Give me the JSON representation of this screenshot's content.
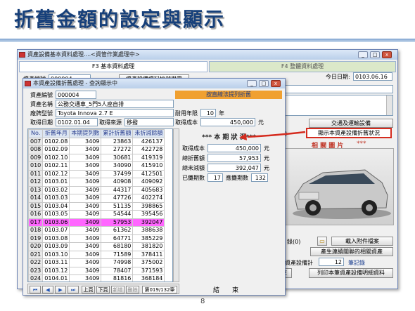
{
  "slide": {
    "title": "折舊金額的設定與顯示",
    "page_number": "8"
  },
  "back_window": {
    "title": "資產設備基本資料處理....<資管作業處理中>",
    "tab_f3": "F3 基本資料處理",
    "tab_f4": "F4 整體資料處理",
    "today_label": "今日日期:",
    "today_value": "0103.06.16",
    "asset_no_label": "資產編號",
    "asset_no_value": "000004",
    "history_button": "資產設備資料挫啟與露",
    "spec_value": "2.7 E",
    "transfer_button": "交通及運輸設備",
    "depr_status_button": "顯示本資產設備折舊狀況",
    "photo_label": "相 關 圖 片",
    "record_label": "錄(0)",
    "attachment_button": "載入附件檔案",
    "related_docs_button": "產生連續關聯的相關資產",
    "asset_count_label": "資產設備計",
    "asset_count_value": "12",
    "record_unit": "筆記錄",
    "end_button": "結束",
    "list_button": "列印本筆資產設備明細資料"
  },
  "front_window": {
    "title": "本資產設備折舊處理 - 查詢顯示中",
    "asset_no_label": "資產編號",
    "asset_no_value": "000004",
    "name_label": "資產名稱",
    "name_value": "公務交通車_5門5人座自排",
    "brand_label": "廠牌型號",
    "brand_value": "Toyota Innova 2.7 E",
    "life_label": "耐用年限",
    "life_value": "10",
    "life_unit": "年",
    "acq_date_label": "取得日期",
    "acq_date_value": "0102.01.04",
    "source_label": "取得來源",
    "source_value": "移撥",
    "cost_label": "取得成本",
    "cost_value": "450,000",
    "cost_unit": "元",
    "method_value": "按直線法提列折舊",
    "status_heading": "*** 本 期 狀 況***",
    "status_cost_label": "取得成本",
    "status_cost_value": "450,000",
    "total_depr_label": "總折舊額",
    "total_depr_value": "57,953",
    "remaining_label": "總未減額",
    "remaining_value": "392,047",
    "used_periods_label": "已攤期數",
    "used_periods_value": "17",
    "remaining_periods_label": "應攤期數",
    "remaining_periods_value": "132",
    "bottom_label": "結　　束",
    "table": {
      "headers": [
        "No.",
        "折舊年月",
        "本期提列數",
        "累計折舊額",
        "未折減餘額"
      ],
      "rows": [
        [
          "007",
          "0102.08",
          "3409",
          "23863",
          "426137"
        ],
        [
          "008",
          "0102.09",
          "3409",
          "27272",
          "422728"
        ],
        [
          "009",
          "0102.10",
          "3409",
          "30681",
          "419319"
        ],
        [
          "010",
          "0102.11",
          "3409",
          "34090",
          "415910"
        ],
        [
          "011",
          "0102.12",
          "3409",
          "37499",
          "412501"
        ],
        [
          "012",
          "0103.01",
          "3409",
          "40908",
          "409092"
        ],
        [
          "013",
          "0103.02",
          "3409",
          "44317",
          "405683"
        ],
        [
          "014",
          "0103.03",
          "3409",
          "47726",
          "402274"
        ],
        [
          "015",
          "0103.04",
          "3409",
          "51135",
          "398865"
        ],
        [
          "016",
          "0103.05",
          "3409",
          "54544",
          "395456"
        ],
        [
          "017",
          "0103.06",
          "3409",
          "57953",
          "392047"
        ],
        [
          "018",
          "0103.07",
          "3409",
          "61362",
          "388638"
        ],
        [
          "019",
          "0103.08",
          "3409",
          "64771",
          "385229"
        ],
        [
          "020",
          "0103.09",
          "3409",
          "68180",
          "381820"
        ],
        [
          "021",
          "0103.10",
          "3409",
          "71589",
          "378411"
        ],
        [
          "022",
          "0103.11",
          "3409",
          "74998",
          "375002"
        ],
        [
          "023",
          "0103.12",
          "3409",
          "78407",
          "371593"
        ],
        [
          "024",
          "0104.01",
          "3409",
          "81816",
          "368184"
        ],
        [
          "025",
          "0104.02",
          "3409",
          "85225",
          "364775"
        ]
      ],
      "selected_row": 10
    },
    "nav": {
      "prev_page": "上頁",
      "next_page": "下頁",
      "add": "新增",
      "delete": "刪除",
      "record_pos": "第019/132筆"
    }
  },
  "colors": {
    "accent_red": "#d52b1e",
    "title_blue": "#17407a",
    "selected_row": "#ff66ff",
    "method_bar": "#f0a030"
  }
}
